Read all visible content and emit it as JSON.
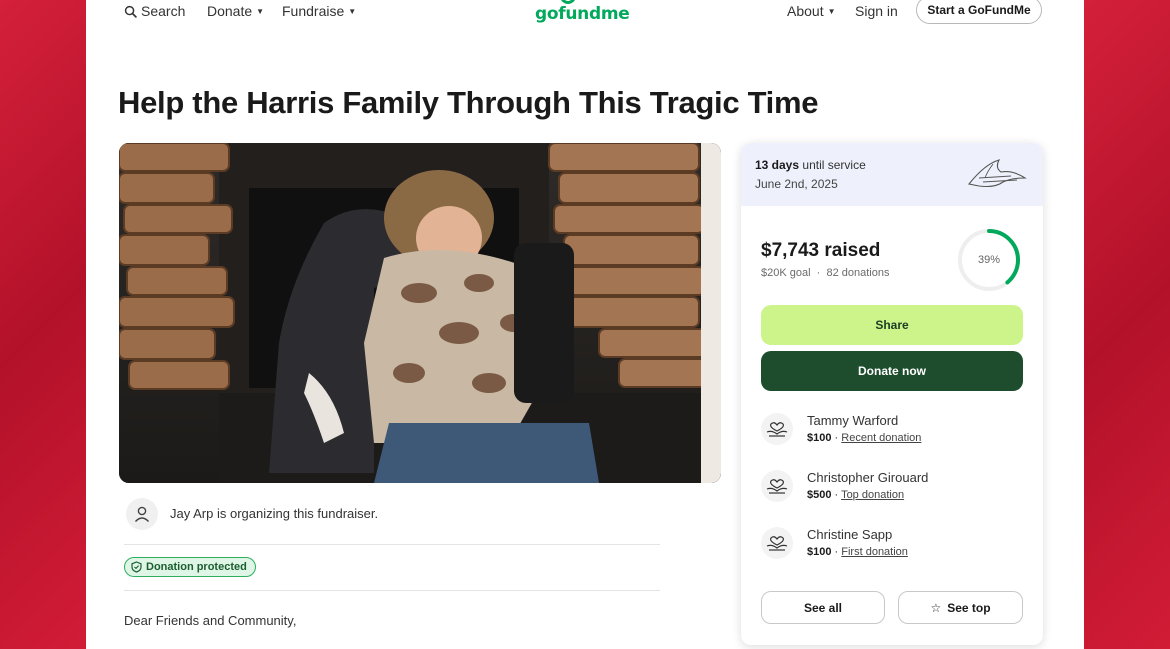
{
  "nav": {
    "search_label": "Search",
    "donate_label": "Donate",
    "fundraise_label": "Fundraise",
    "logo_text": "gofundme",
    "about_label": "About",
    "signin_label": "Sign in",
    "start_label": "Start a GoFundMe"
  },
  "campaign": {
    "title": "Help the Harris Family Through This Tragic Time",
    "organizer_text": "Jay Arp is organizing this fundraiser.",
    "protected_label": "Donation protected",
    "story_opening": "Dear Friends and Community,"
  },
  "service": {
    "days": "13 days",
    "days_suffix": "until service",
    "date": "June 2nd, 2025"
  },
  "progress": {
    "raised": "$7,743 raised",
    "goal": "$20K goal",
    "donations": "82 donations",
    "percent_label": "39%",
    "percent": 0.39
  },
  "actions": {
    "share_label": "Share",
    "donate_label": "Donate now",
    "see_all_label": "See all",
    "see_top_label": "See top"
  },
  "donors": [
    {
      "name": "Tammy Warford",
      "amount": "$100",
      "tag": "Recent donation"
    },
    {
      "name": "Christopher Girouard",
      "amount": "$500",
      "tag": "Top donation"
    },
    {
      "name": "Christine Sapp",
      "amount": "$100",
      "tag": "First donation"
    }
  ],
  "colors": {
    "brand_green": "#02a95c",
    "share_bg": "#cdf48b",
    "donate_bg": "#1e4d2e",
    "background_red": "#c8102e"
  }
}
